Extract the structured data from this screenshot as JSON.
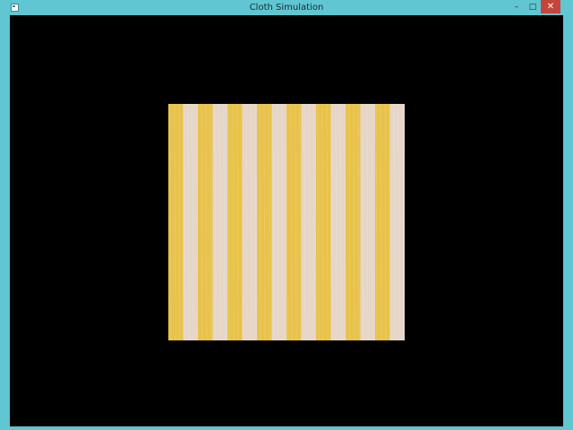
{
  "window": {
    "title": "Cloth Simulation",
    "icon": "app-window-icon",
    "controls": {
      "minimize": "–",
      "maximize": "□",
      "close": "✕"
    }
  },
  "scene": {
    "background": "#000000",
    "cloth": {
      "pattern": "vertical-stripes",
      "stripe_color_a": "#e8c24a",
      "stripe_color_b": "#e6d6c8",
      "stripe_count": 16
    }
  },
  "colors": {
    "frame": "#5fc6d2",
    "close_button": "#c6453b"
  }
}
